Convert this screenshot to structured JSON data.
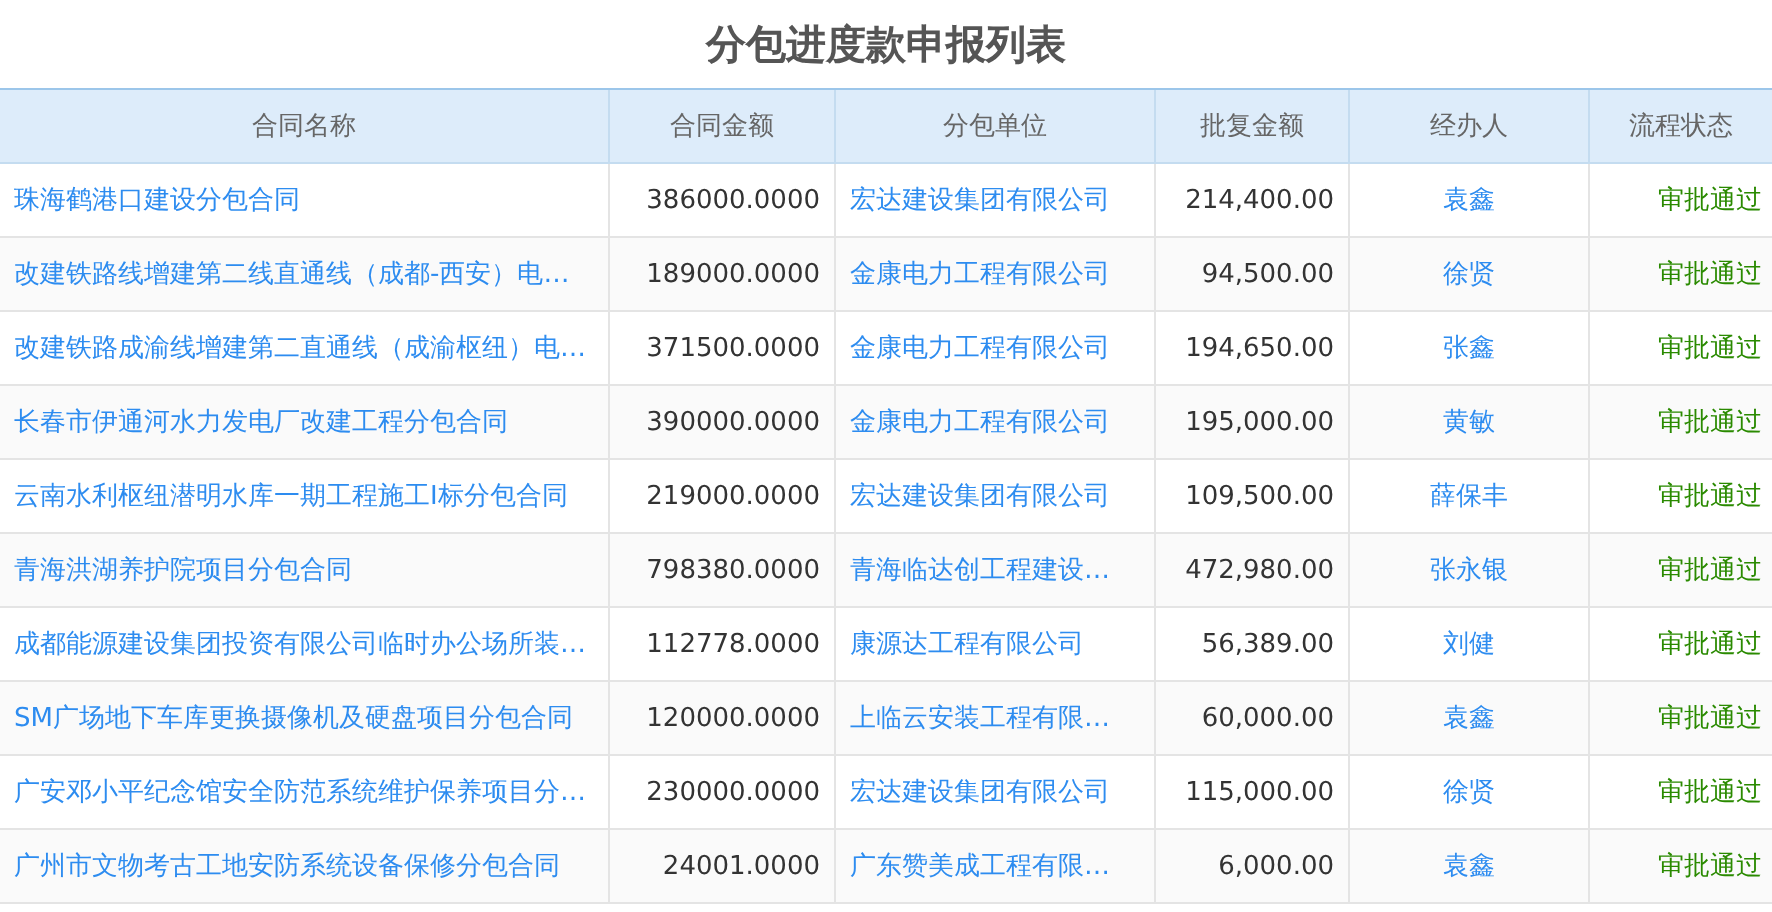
{
  "title": "分包进度款申报列表",
  "table": {
    "columns": [
      "合同名称",
      "合同金额",
      "分包单位",
      "批复金额",
      "经办人",
      "流程状态"
    ],
    "rows": [
      [
        "珠海鹤港口建设分包合同",
        "386000.0000",
        "宏达建设集团有限公司",
        "214,400.00",
        "袁鑫",
        "审批通过"
      ],
      [
        "改建铁路线增建第二线直通线（成都-西安）电…",
        "189000.0000",
        "金康电力工程有限公司",
        "94,500.00",
        "徐贤",
        "审批通过"
      ],
      [
        "改建铁路成渝线增建第二直通线（成渝枢纽）电…",
        "371500.0000",
        "金康电力工程有限公司",
        "194,650.00",
        "张鑫",
        "审批通过"
      ],
      [
        "长春市伊通河水力发电厂改建工程分包合同",
        "390000.0000",
        "金康电力工程有限公司",
        "195,000.00",
        "黄敏",
        "审批通过"
      ],
      [
        "云南水利枢纽潜明水库一期工程施工I标分包合同",
        "219000.0000",
        "宏达建设集团有限公司",
        "109,500.00",
        "薛保丰",
        "审批通过"
      ],
      [
        "青海洪湖养护院项目分包合同",
        "798380.0000",
        "青海临达创工程建设…",
        "472,980.00",
        "张永银",
        "审批通过"
      ],
      [
        "成都能源建设集团投资有限公司临时办公场所装…",
        "112778.0000",
        "康源达工程有限公司",
        "56,389.00",
        "刘健",
        "审批通过"
      ],
      [
        "SM广场地下车库更换摄像机及硬盘项目分包合同",
        "120000.0000",
        "上临云安装工程有限…",
        "60,000.00",
        "袁鑫",
        "审批通过"
      ],
      [
        "广安邓小平纪念馆安全防范系统维护保养项目分…",
        "230000.0000",
        "宏达建设集团有限公司",
        "115,000.00",
        "徐贤",
        "审批通过"
      ],
      [
        "广州市文物考古工地安防系统设备保修分包合同",
        "24001.0000",
        "广东赞美成工程有限…",
        "6,000.00",
        "袁鑫",
        "审批通过"
      ]
    ]
  }
}
